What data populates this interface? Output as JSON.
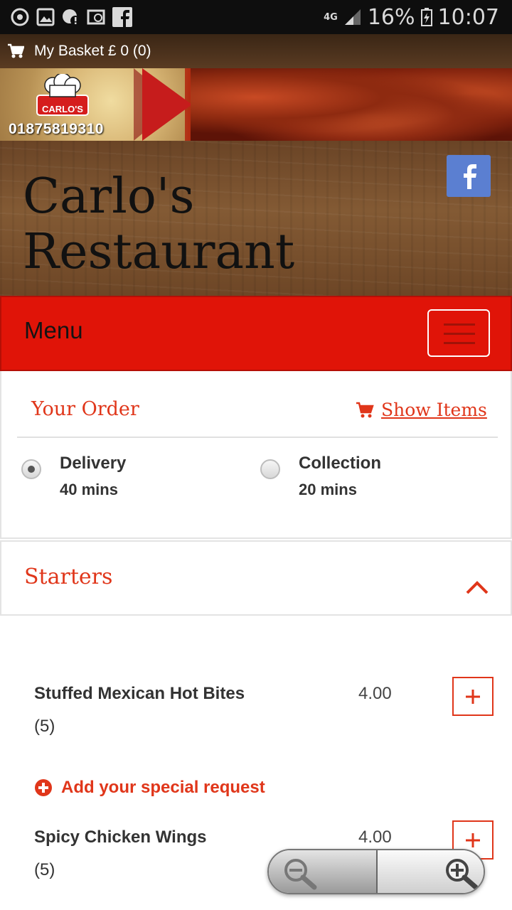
{
  "status_bar": {
    "network": "4G",
    "battery": "16%",
    "time": "10:07",
    "left_icons": [
      "sync-icon",
      "gallery-icon",
      "alert-icon",
      "email-icon",
      "facebook-icon"
    ]
  },
  "basket": {
    "label": "My Basket £ 0 (0)"
  },
  "banner": {
    "logo_text": "CARLO'S",
    "phone": "01875819310"
  },
  "header": {
    "title_line1": "Carlo's",
    "title_line2": "Restaurant"
  },
  "menu_bar": {
    "label": "Menu"
  },
  "order": {
    "title": "Your Order",
    "show_items": "Show Items",
    "options": [
      {
        "label": "Delivery",
        "time": "40 mins",
        "selected": true
      },
      {
        "label": "Collection",
        "time": "20 mins",
        "selected": false
      }
    ]
  },
  "section": {
    "title": "Starters",
    "expanded": true
  },
  "items": [
    {
      "name": "Stuffed Mexican Hot Bites",
      "qty": "(5)",
      "price": "4.00"
    },
    {
      "name": "Spicy Chicken Wings",
      "qty": "(5)",
      "price": "4.00"
    }
  ],
  "special_request": {
    "label": "Add your special request"
  },
  "colors": {
    "accent": "#e0361a",
    "menu_bar": "#e01408",
    "facebook": "#5b7fd1"
  }
}
